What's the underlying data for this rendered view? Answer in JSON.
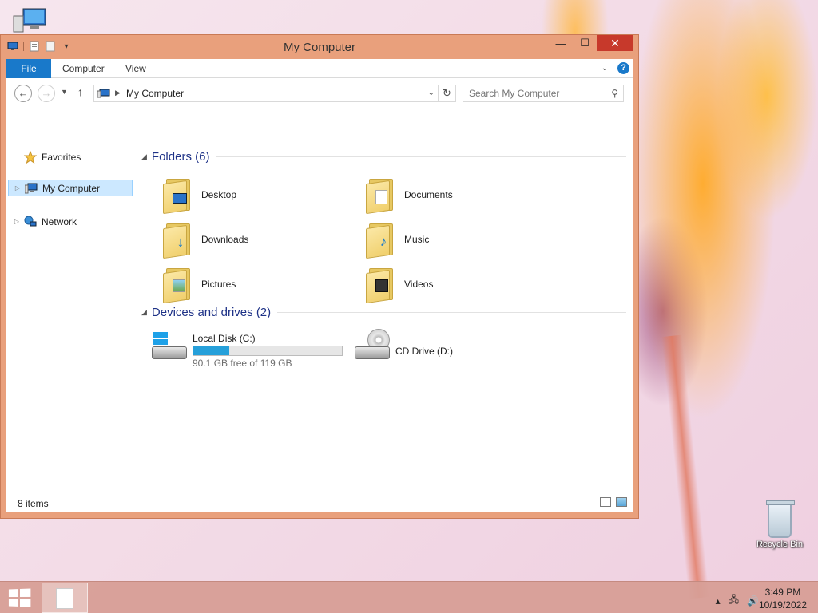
{
  "window": {
    "title": "My Computer",
    "close_glyph": "✕",
    "min_glyph": "—",
    "max_glyph": "☐"
  },
  "ribbon": {
    "tabs": [
      {
        "label": "File"
      },
      {
        "label": "Computer"
      },
      {
        "label": "View"
      }
    ],
    "help_glyph": "?"
  },
  "navigation": {
    "address_crumb": "My Computer",
    "search_placeholder": "Search My Computer"
  },
  "nav_pane": {
    "items": [
      {
        "label": "Favorites",
        "icon": "star-icon"
      },
      {
        "label": "My Computer",
        "icon": "computer-icon",
        "selected": true
      },
      {
        "label": "Network",
        "icon": "network-icon"
      }
    ]
  },
  "folders": {
    "heading": "Folders (6)",
    "items": [
      {
        "label": "Desktop",
        "icon": "desktop-folder-icon"
      },
      {
        "label": "Documents",
        "icon": "documents-folder-icon"
      },
      {
        "label": "Downloads",
        "icon": "downloads-folder-icon"
      },
      {
        "label": "Music",
        "icon": "music-folder-icon"
      },
      {
        "label": "Pictures",
        "icon": "pictures-folder-icon"
      },
      {
        "label": "Videos",
        "icon": "videos-folder-icon"
      }
    ]
  },
  "devices": {
    "heading": "Devices and drives (2)",
    "items": [
      {
        "label": "Local Disk (C:)",
        "free_text": "90.1 GB free of 119 GB",
        "used_fraction": 0.243,
        "icon": "hard-drive-icon"
      },
      {
        "label": "CD Drive (D:)",
        "icon": "cd-drive-icon"
      }
    ]
  },
  "status_bar": {
    "item_count": "8 items"
  },
  "desktop": {
    "recycle_bin_label": "Recycle Bin"
  },
  "taskbar": {
    "time": "3:49 PM",
    "date": "10/19/2022"
  },
  "colors": {
    "accent": "#1979ca",
    "window_frame": "#e9a07c",
    "progress": "#26a0da",
    "selection": "#cce8ff"
  }
}
